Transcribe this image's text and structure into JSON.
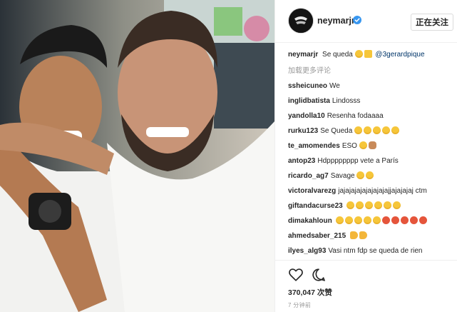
{
  "post": {
    "image_alt": "Two men smiling together for a selfie",
    "author": {
      "username": "neymarjr",
      "verified": true
    },
    "follow_button": "正在关注",
    "caption": {
      "username": "neymarjr",
      "text": "Se queda",
      "mention": "@3gerardpique"
    },
    "load_more": "加载更多评论",
    "comments": [
      {
        "username": "ssheicuneo",
        "text": "We"
      },
      {
        "username": "inglidbatista",
        "text": "Lindosss"
      },
      {
        "username": "yandolla10",
        "text": "Resenha fodaaaa"
      },
      {
        "username": "rurku123",
        "text": "Se Queda"
      },
      {
        "username": "te_amomendes",
        "text": "ESO"
      },
      {
        "username": "antop23",
        "text": "Hdpppppppp vete a París"
      },
      {
        "username": "ricardo_ag7",
        "text": "Savage"
      },
      {
        "username": "victoralvarezg",
        "text": "jajajajajajajajajajjajajajaj ctm"
      },
      {
        "username": "giftandacurse23",
        "text": ""
      },
      {
        "username": "dimakahloun",
        "text": ""
      },
      {
        "username": "ahmedsaber_215",
        "text": ""
      },
      {
        "username": "ilyes_alg93",
        "text": "Vasi ntm fdp se queda de rien"
      }
    ],
    "likes": "370,047 次赞",
    "time_ago": "7 分钟前"
  },
  "icons": {
    "like": "heart-outline-icon",
    "comment": "speech-bubble-icon",
    "verified": "verified-badge-icon"
  },
  "colors": {
    "verified_blue": "#3897f0",
    "text": "#262626",
    "muted": "#999999",
    "mention": "#003569"
  }
}
